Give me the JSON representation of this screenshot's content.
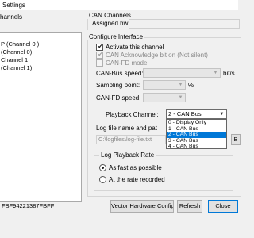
{
  "window": {
    "title": "Settings"
  },
  "left_pane": {
    "header": "hannels",
    "tree_items": [
      {
        "label": "P (Channel 0 )"
      },
      {
        "label": "(Channel 0)"
      },
      {
        "label": "Channel 1"
      },
      {
        "label": "(Channel 1)"
      }
    ]
  },
  "can_channels": {
    "group_label": "CAN Channels",
    "assigned_hw_label": "Assigned hw",
    "assigned_hw_value": ""
  },
  "configure": {
    "group_label": "Configure Interface",
    "activate_label": "Activate this channel",
    "activate_checked": true,
    "can_ack_label": "CAN Acknowledge bit on (Not silent)",
    "can_ack_checked": true,
    "canfd_label": "CAN-FD mode",
    "canfd_checked": false,
    "bus_speed_label": "CAN-Bus speed:",
    "bus_speed_unit": "bit/s",
    "sampling_label": "Sampling point:",
    "sampling_unit": "%",
    "canfd_speed_label": "CAN-FD speed:",
    "playback_label": "Playback Channel:",
    "playback_selected": "2 - CAN Bus",
    "playback_options": [
      "0 - Display Only",
      "1 - CAN Bus",
      "2 - CAN Bus",
      "3 - CAN Bus",
      "4 - CAN Bus"
    ],
    "playback_selected_index": 2,
    "logfile_label": "Log file name and pat",
    "logfile_value": "C:\\logfiles\\log-file.txt",
    "browse_label": "B"
  },
  "playback_rate": {
    "group_label": "Log Playback Rate",
    "fast_label": "As fast as possible",
    "recorded_label": "At the rate recorded",
    "selected": "fast"
  },
  "footer": {
    "hw_id": "FBF94221387FBFF",
    "vector_button": "Vector Hardware Config...",
    "refresh_button": "Refresh",
    "close_button": "Close"
  }
}
